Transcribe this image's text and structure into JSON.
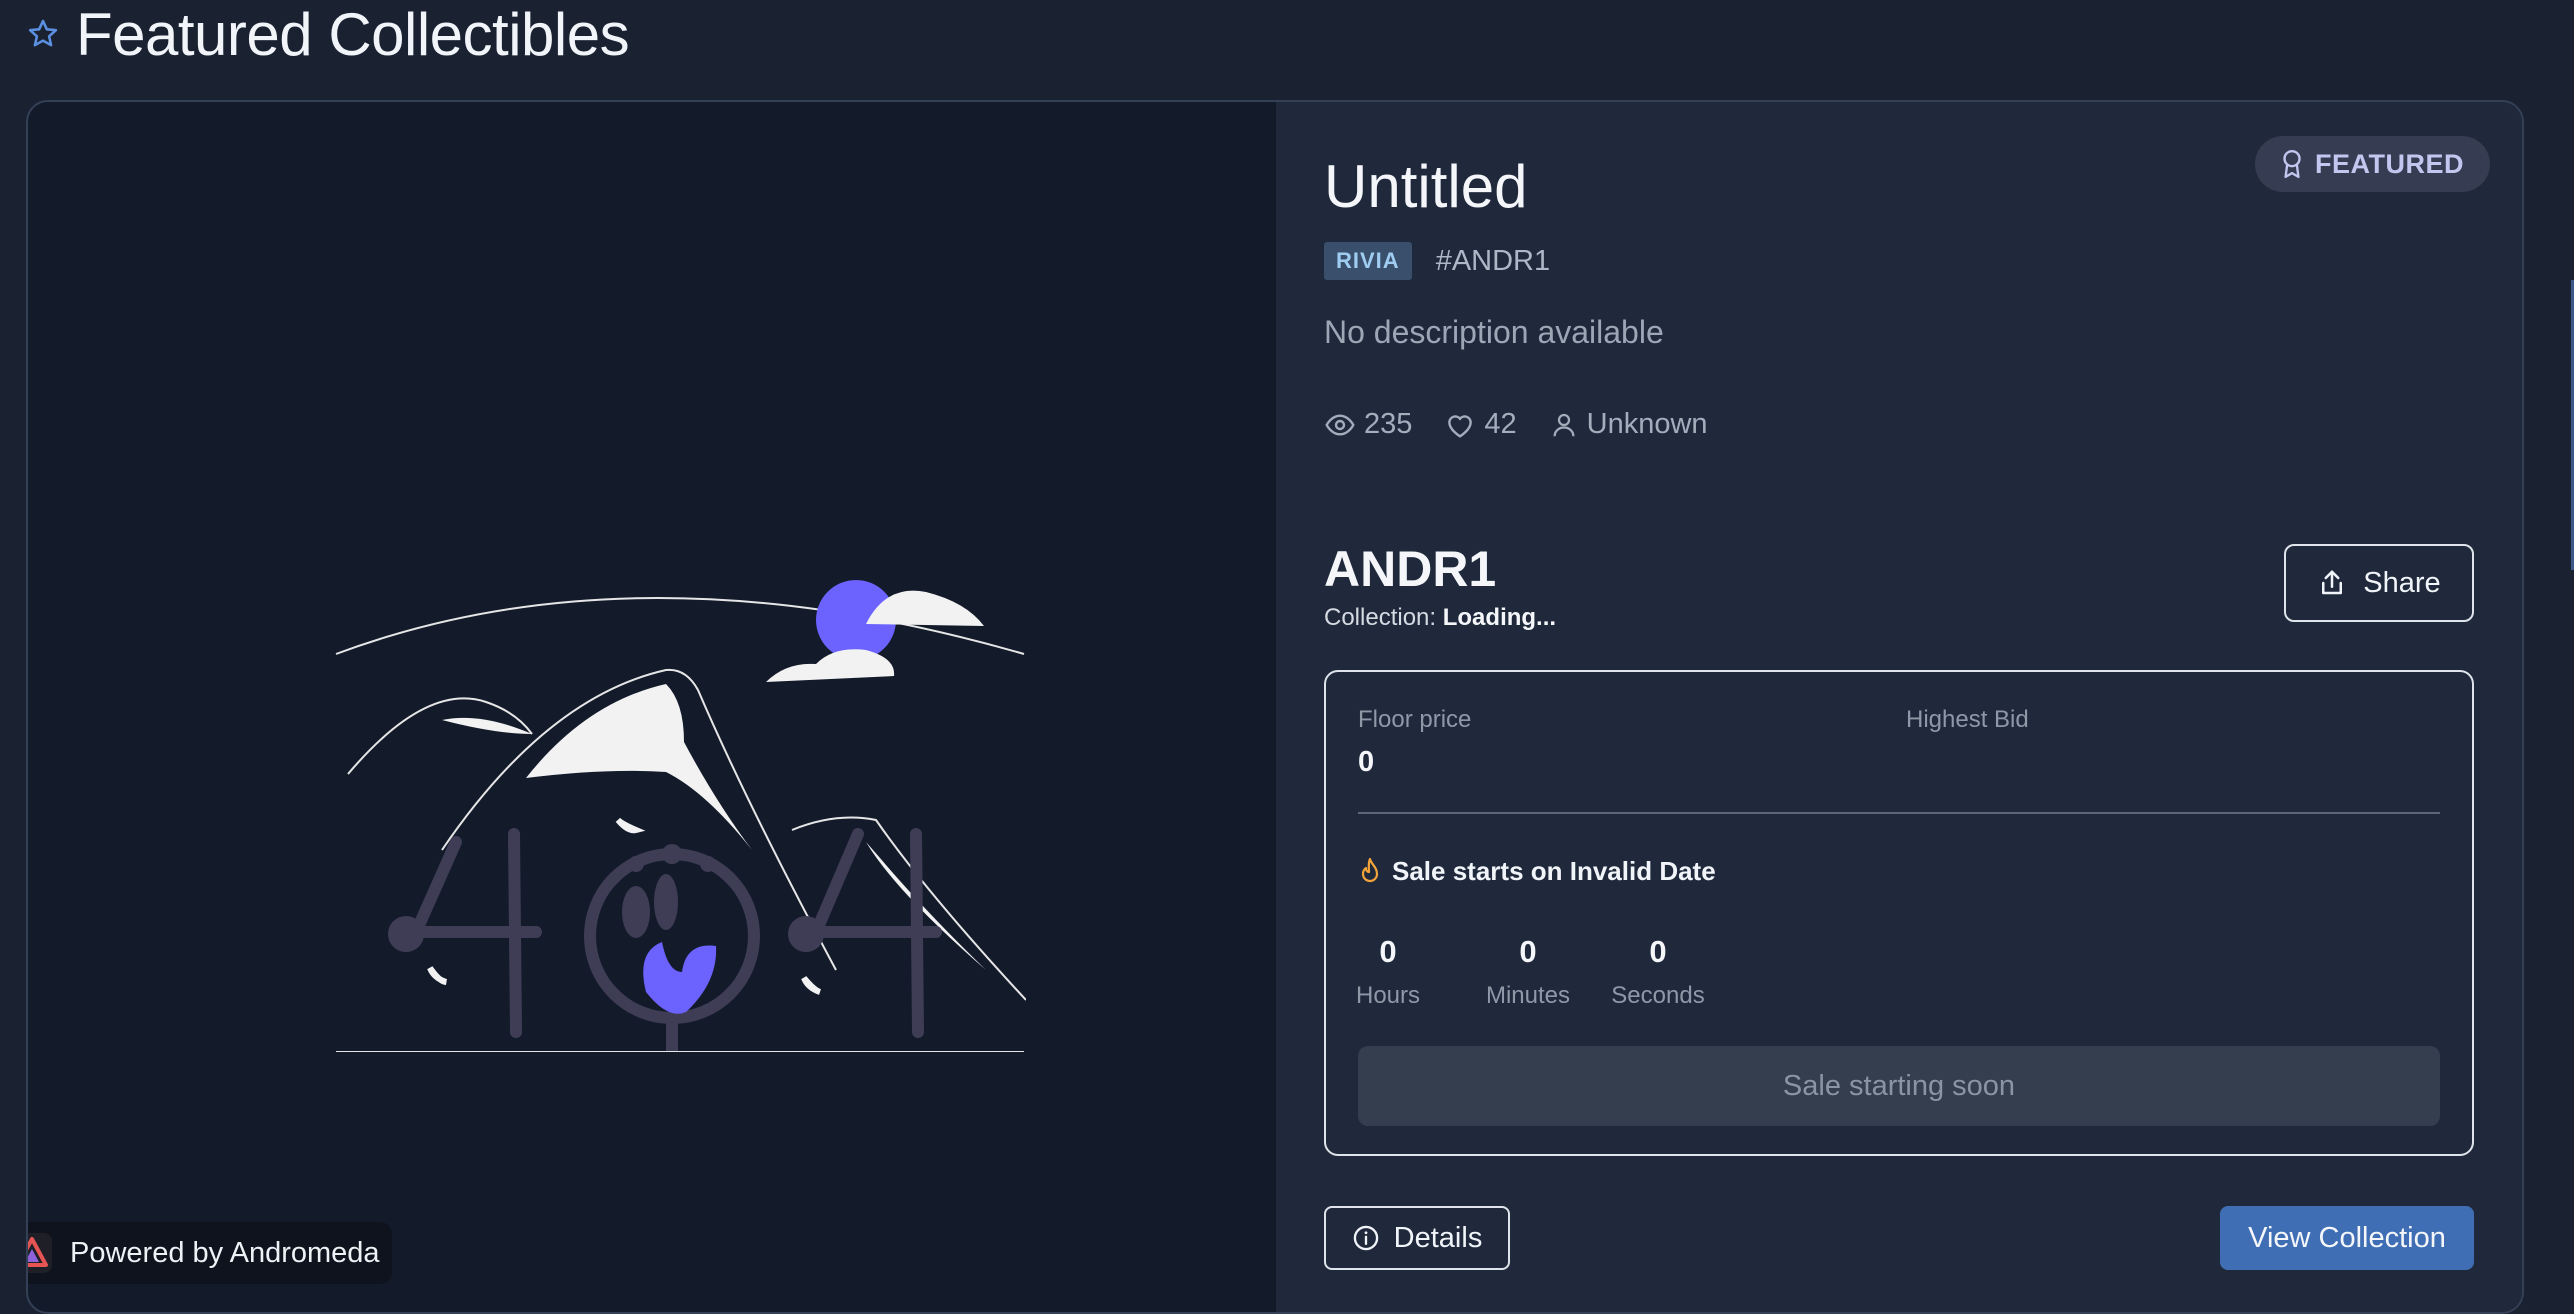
{
  "header": {
    "title": "Featured Collectibles",
    "icon": "star-icon"
  },
  "media": {
    "illustration": "404-not-found-illustration",
    "accent_color": "#6c63ff"
  },
  "powered_by": {
    "label": "Powered by Andromeda",
    "icon": "andromeda-logo"
  },
  "nft": {
    "badge": "FEATURED",
    "title": "Untitled",
    "chain": "RIVIA",
    "token_id": "#ANDR1",
    "description": "No description available",
    "views": "235",
    "likes": "42",
    "owner": "Unknown"
  },
  "token": {
    "name": "ANDR1",
    "collection_label": "Collection:",
    "collection_value": "Loading...",
    "share_label": "Share"
  },
  "sale": {
    "floor_price_label": "Floor price",
    "floor_price_value": "0",
    "highest_bid_label": "Highest Bid",
    "highest_bid_value": "",
    "starts_text": "Sale starts on Invalid Date",
    "countdown": [
      {
        "value": "0",
        "unit": "Hours"
      },
      {
        "value": "0",
        "unit": "Minutes"
      },
      {
        "value": "0",
        "unit": "Seconds"
      }
    ],
    "status_button": "Sale starting soon"
  },
  "actions": {
    "details_label": "Details",
    "view_collection_label": "View Collection"
  },
  "colors": {
    "background": "#1a2232",
    "accent_blue": "#3f6eb4",
    "badge_text": "#c2c7f0",
    "flame": "#f2a33a"
  }
}
